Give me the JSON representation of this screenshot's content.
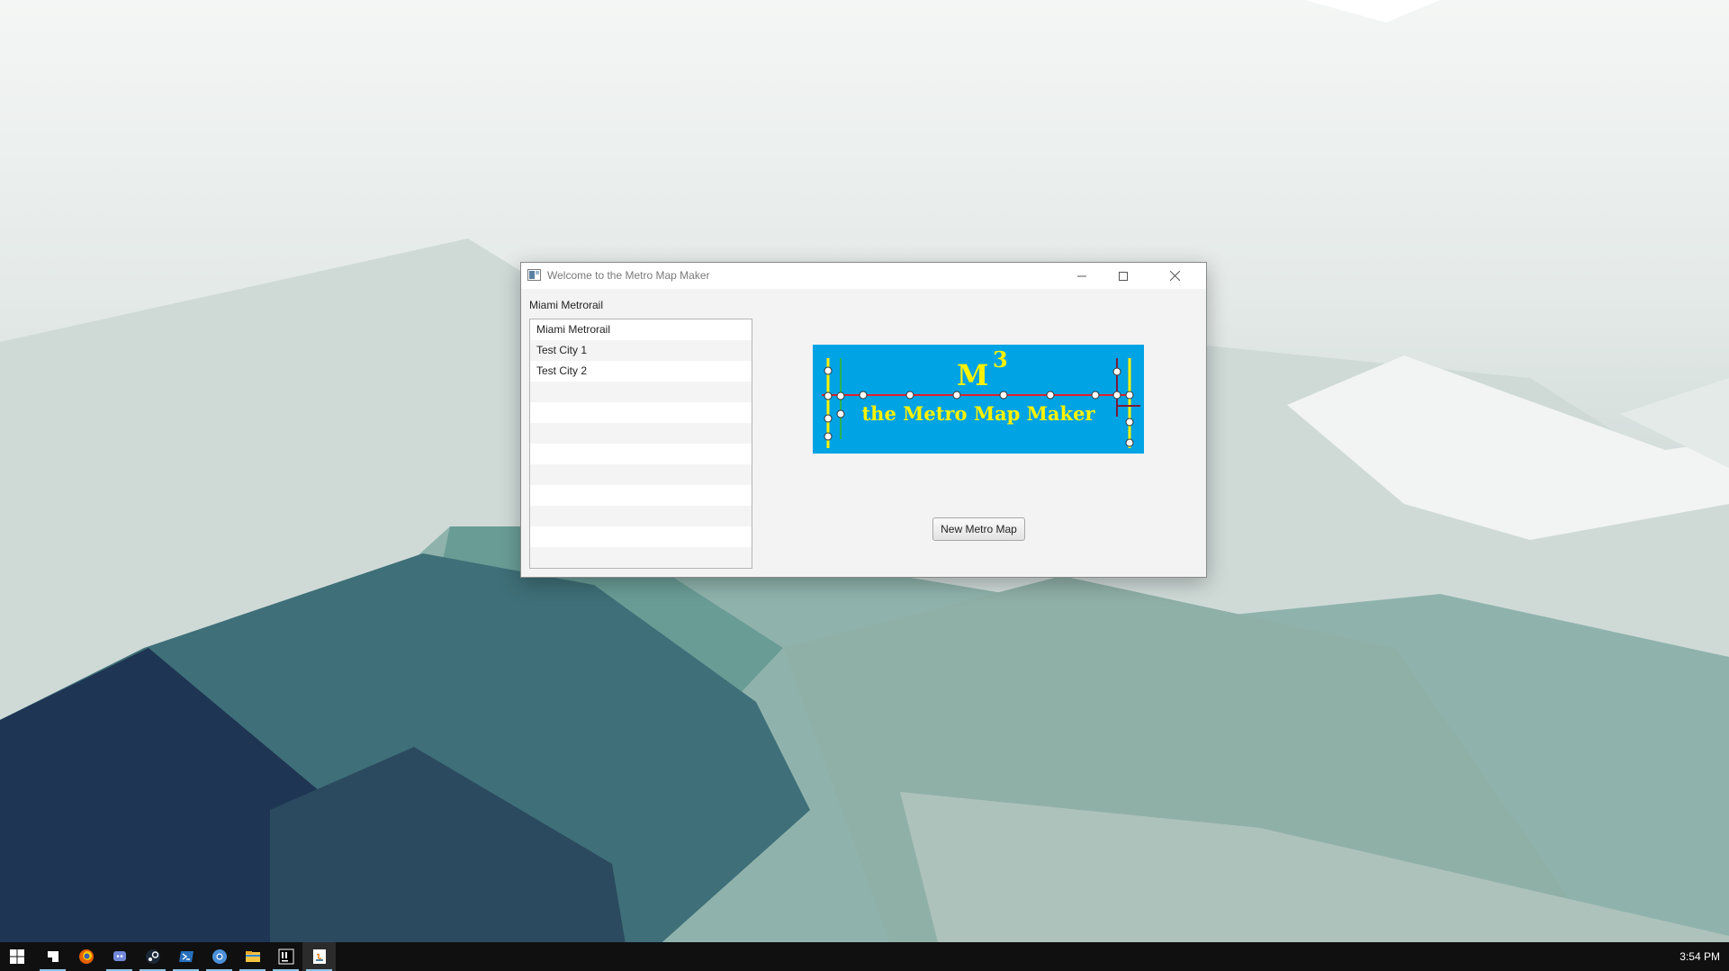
{
  "window": {
    "title": "Welcome to the Metro Map Maker",
    "selected_map_label": "Miami Metrorail",
    "recent_maps": [
      "Miami Metrorail",
      "Test City 1",
      "Test City 2"
    ],
    "empty_rows": 8,
    "new_map_button": "New Metro Map",
    "logo": {
      "title_text": "M",
      "superscript": "3",
      "subtitle": "the Metro Map Maker",
      "background": "#00a3e4",
      "text_color": "#fff200",
      "line_color": "#e0202a"
    }
  },
  "taskbar": {
    "icons": [
      "windows-start-icon",
      "task-view-icon",
      "firefox-icon",
      "discord-icon",
      "steam-icon",
      "powershell-icon",
      "chromium-icon",
      "file-explorer-icon",
      "intellij-icon",
      "java-app-icon"
    ],
    "clock": "3:54 PM"
  },
  "colors": {
    "taskbar": "#101010",
    "accent": "#8fc5e8"
  }
}
